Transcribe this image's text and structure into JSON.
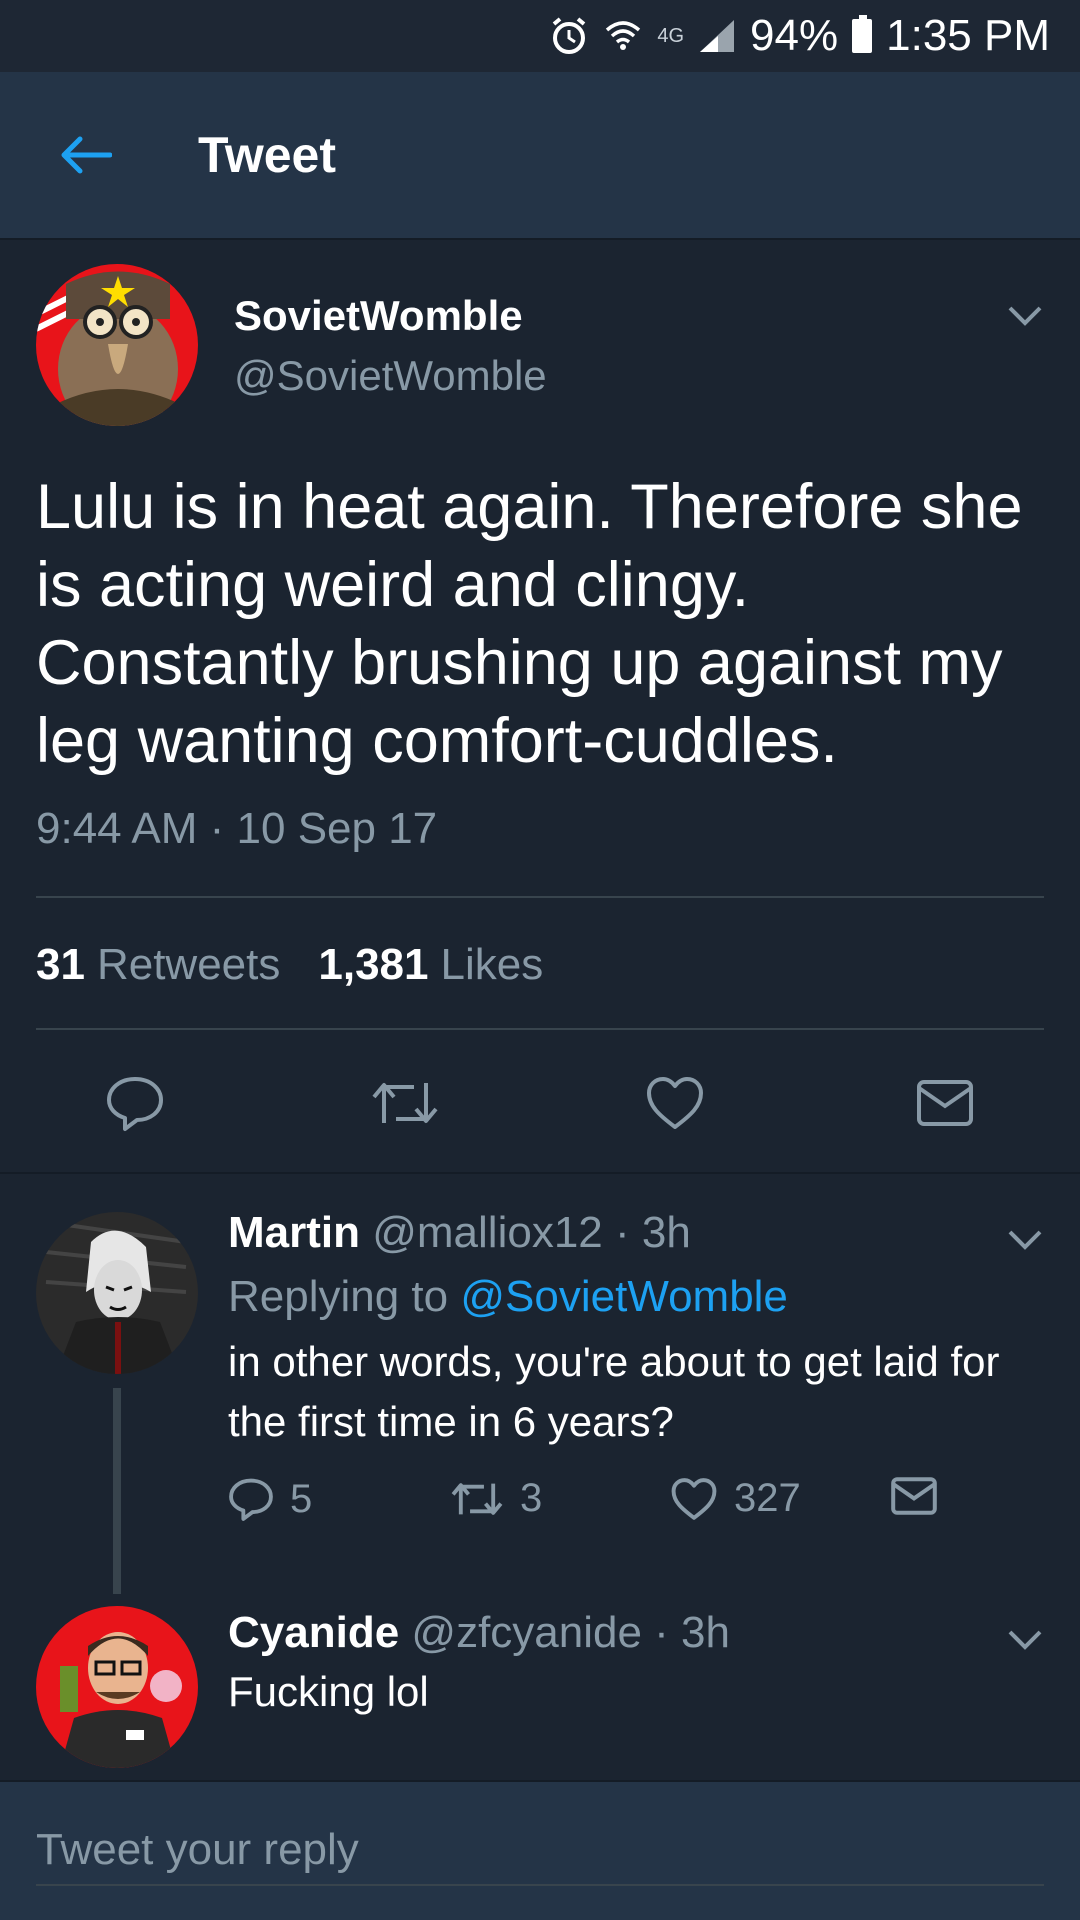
{
  "status_bar": {
    "network": "4G",
    "battery": "94%",
    "time": "1:35 PM",
    "icons": [
      "alarm-icon",
      "wifi-icon",
      "signal-icon",
      "battery-icon"
    ]
  },
  "header": {
    "back_icon": "back-arrow-icon",
    "title": "Tweet"
  },
  "main_tweet": {
    "author_name": "SovietWomble",
    "author_handle": "@SovietWomble",
    "text": "Lulu is in heat again. Therefore she is acting weird and clingy. Constantly brushing up against my leg wanting comfort-cuddles.",
    "timestamp": "9:44 AM · 10 Sep 17",
    "retweets_count": "31",
    "retweets_label": "Retweets",
    "likes_count": "1,381",
    "likes_label": "Likes",
    "actions": [
      "reply-icon",
      "retweet-icon",
      "like-icon",
      "message-icon"
    ]
  },
  "replies": [
    {
      "name": "Martin",
      "meta": "@malliox12 · 3h",
      "replying_prefix": "Replying to",
      "replying_to": "@SovietWomble",
      "text": "in other words, you're about to get laid for the first time in 6 years?",
      "reply_count": "5",
      "retweet_count": "3",
      "like_count": "327"
    },
    {
      "name": "Cyanide",
      "meta": "@zfcyanide · 3h",
      "text": "Fucking lol"
    }
  ],
  "composer": {
    "placeholder": "Tweet your reply"
  },
  "colors": {
    "background": "#1b2430",
    "header": "#243447",
    "muted_text": "#8899a6",
    "accent": "#1da1f2",
    "divider": "#38444d"
  }
}
